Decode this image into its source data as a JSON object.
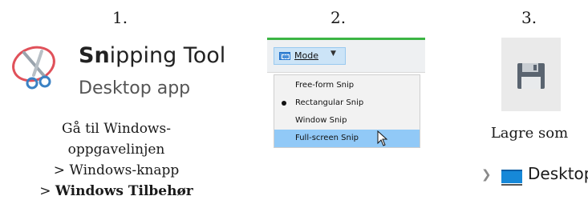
{
  "steps": [
    {
      "number": "1."
    },
    {
      "number": "2."
    },
    {
      "number": "3."
    }
  ],
  "step1": {
    "app_name_bold": "Sn",
    "app_name_rest": "ipping Tool",
    "app_subtitle": "Desktop app",
    "icon": "snipping-tool-icon",
    "instructions": [
      "Gå til Windows-",
      "oppgavelinjen",
      "> Windows-knapp"
    ],
    "instruction_bold_prefix": "> ",
    "instruction_bold": "Windows Tilbehør"
  },
  "step2": {
    "mode_label": "Mode",
    "mode_icon": "rectangle-snip-icon",
    "menu_items": [
      {
        "label": "Free-form Snip",
        "selected": false,
        "highlighted": false
      },
      {
        "label": "Rectangular Snip",
        "selected": true,
        "highlighted": false
      },
      {
        "label": "Window Snip",
        "selected": false,
        "highlighted": false
      },
      {
        "label": "Full-screen Snip",
        "selected": false,
        "highlighted": true
      }
    ],
    "accent_color": "#3cb544",
    "highlight_color": "#91c9f7"
  },
  "step3": {
    "icon": "save-icon",
    "caption": "Lagre som",
    "tree_item": "Desktop",
    "tree_icon": "desktop-folder-icon"
  }
}
